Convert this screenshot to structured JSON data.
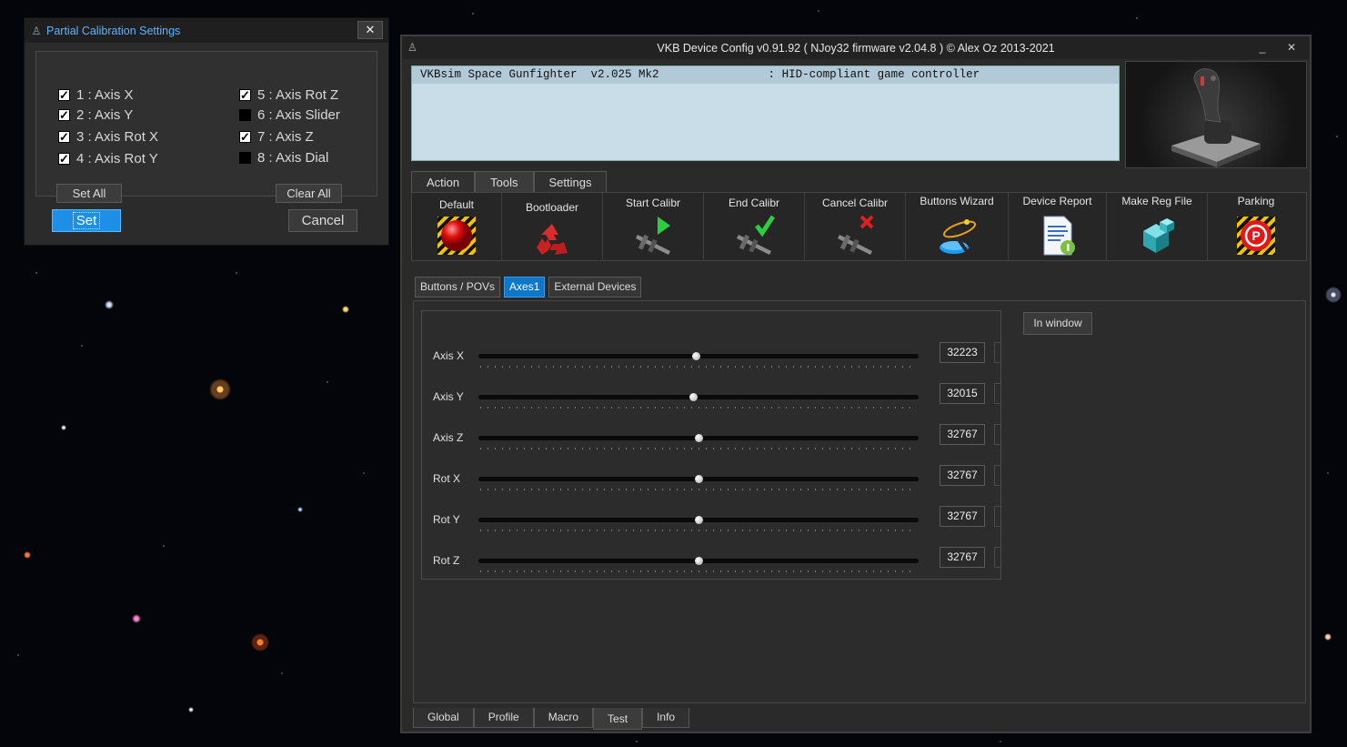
{
  "partial_dialog": {
    "title": "Partial Calibration Settings",
    "close_glyph": "✕",
    "checks_left": [
      {
        "label": "1 : Axis X",
        "checked": true
      },
      {
        "label": "2 : Axis Y",
        "checked": true
      },
      {
        "label": "3 : Axis Rot X",
        "checked": true
      },
      {
        "label": "4 : Axis Rot Y",
        "checked": true
      }
    ],
    "checks_right": [
      {
        "label": "5 : Axis Rot Z",
        "checked": true
      },
      {
        "label": "6 : Axis Slider",
        "checked": false
      },
      {
        "label": "7 : Axis Z",
        "checked": true
      },
      {
        "label": "8 : Axis Dial",
        "checked": false
      }
    ],
    "set_all": "Set All",
    "clear_all": "Clear All",
    "set": "Set",
    "cancel": "Cancel"
  },
  "main_window": {
    "title": "VKB Device Config v0.91.92 ( NJoy32 firmware v2.04.8 ) © Alex Oz 2013-2021",
    "minimize_glyph": "_",
    "close_glyph": "✕",
    "device_row": "VKBsim Space Gunfighter  v2.025 Mk2                : HID-compliant game controller",
    "top_tabs": [
      "Action",
      "Tools",
      "Settings"
    ],
    "active_top_tab": "Tools",
    "tools": [
      {
        "label": "Default",
        "icon": "red-button-icon"
      },
      {
        "label": "Bootloader",
        "icon": "recycle-icon"
      },
      {
        "label": "Start Calibr",
        "icon": "caliper-play-icon"
      },
      {
        "label": "End Calibr",
        "icon": "caliper-check-icon"
      },
      {
        "label": "Cancel Calibr",
        "icon": "caliper-cancel-icon"
      },
      {
        "label": "Buttons Wizard",
        "icon": "wand-icon"
      },
      {
        "label": "Device Report",
        "icon": "report-icon"
      },
      {
        "label": "Make Reg File",
        "icon": "registry-icon"
      },
      {
        "label": "Parking",
        "icon": "parking-icon"
      }
    ],
    "sub_tabs": [
      "Buttons / POVs",
      "Axes1",
      "External Devices"
    ],
    "active_sub_tab": "Axes1",
    "axes": [
      {
        "name": "Axis X",
        "value": "32223",
        "position": 0.493
      },
      {
        "name": "Axis Y",
        "value": "32015",
        "position": 0.488
      },
      {
        "name": "Axis Z",
        "value": "32767",
        "position": 0.5
      },
      {
        "name": "Rot X",
        "value": "32767",
        "position": 0.5
      },
      {
        "name": "Rot Y",
        "value": "32767",
        "position": 0.5
      },
      {
        "name": "Rot Z",
        "value": "32767",
        "position": 0.5
      }
    ],
    "in_window": "In window",
    "bottom_tabs": [
      "Global",
      "Profile",
      "Macro",
      "Test",
      "Info"
    ],
    "active_bottom_tab": "Test"
  }
}
